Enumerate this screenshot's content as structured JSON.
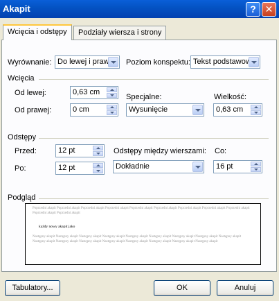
{
  "window": {
    "title": "Akapit"
  },
  "tabs": [
    {
      "label": "Wcięcia i odstępy"
    },
    {
      "label": "Podziały wiersza i strony"
    }
  ],
  "general": {
    "alignment_label": "Wyrównanie:",
    "alignment_value": "Do lewej i praw",
    "outline_label": "Poziom konspektu:",
    "outline_value": "Tekst podstawow"
  },
  "indent": {
    "section_label": "Wcięcia",
    "left_label": "Od lewej:",
    "left_value": "0,63 cm",
    "right_label": "Od prawej:",
    "right_value": "0 cm",
    "special_label": "Specjalne:",
    "special_value": "Wysunięcie",
    "by_label": "Wielkość:",
    "by_value": "0,63 cm"
  },
  "spacing": {
    "section_label": "Odstępy",
    "before_label": "Przed:",
    "before_value": "12 pt",
    "after_label": "Po:",
    "after_value": "12 pt",
    "line_label": "Odstępy między wierszami:",
    "line_value": "Dokładnie",
    "at_label": "Co:",
    "at_value": "16 pt"
  },
  "preview": {
    "section_label": "Podgląd",
    "prev_text": "Poprzedni akapit Poprzedni akapit Poprzedni akapit Poprzedni akapit Poprzedni akapit Poprzedni akapit Poprzedni akapit Poprzedni akapit Poprzedni akapit Poprzedni akapit Poprzedni akapit",
    "sample_text": "każdy nowy akapit jako",
    "next_text": "Następny akapit Następny akapit Następny akapit Następny akapit Następny akapit Następny akapit Następny akapit Następny akapit Następny akapit Następny akapit Następny akapit Następny akapit Następny akapit Następny akapit Następny akapit Następny akapit Następny akapit"
  },
  "buttons": {
    "tabs": "Tabulatory...",
    "ok": "OK",
    "cancel": "Anuluj"
  },
  "colors": {
    "titlebar": "#0453c4",
    "dialog_bg": "#ece9d8",
    "tab_accent": "#ffc73c"
  }
}
